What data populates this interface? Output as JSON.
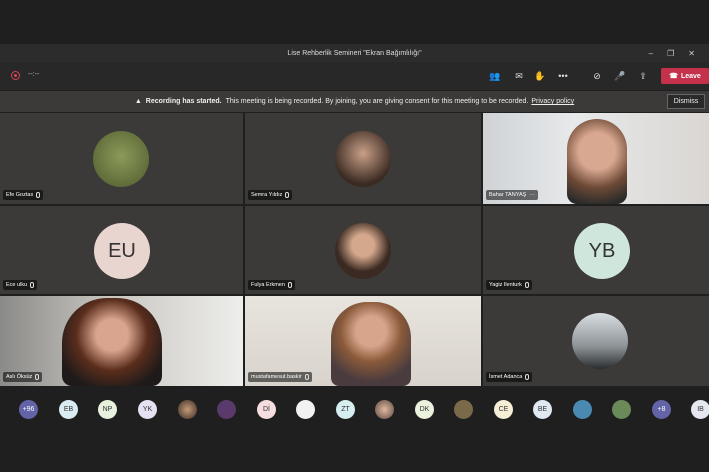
{
  "window": {
    "title": "Lise Rehberlik Semineri \"Ekran Bağımlılığı\""
  },
  "toolbar": {
    "timer": "--:--",
    "leave_label": "Leave"
  },
  "banner": {
    "bold": "Recording has started.",
    "text": "This meeting is being recorded. By joining, you are giving consent for this meeting to be recorded.",
    "link": "Privacy policy",
    "dismiss": "Dismiss"
  },
  "tiles": [
    {
      "name": "Efe Goztas"
    },
    {
      "name": "Semra Yıldız"
    },
    {
      "name": "Bahar TANYAŞ"
    },
    {
      "name": "Ece ulku",
      "initials": "EU"
    },
    {
      "name": "Fulya Erkmen"
    },
    {
      "name": "Yagiz Ilenturk",
      "initials": "YB"
    },
    {
      "name": "Aslı Öksüz"
    },
    {
      "name": "mustafamesut.baskir"
    },
    {
      "name": "İsmet Adanca"
    }
  ],
  "strip": [
    "+96",
    "EB",
    "NP",
    "YK",
    "",
    "",
    "Dİ",
    "",
    "ZT",
    "",
    "DK",
    "",
    "CE",
    "BE",
    "",
    "",
    "+8",
    "IB"
  ],
  "colors": {
    "accent": "#c4314b",
    "tile": "#3b3a39",
    "background": "#1f1f1f"
  }
}
